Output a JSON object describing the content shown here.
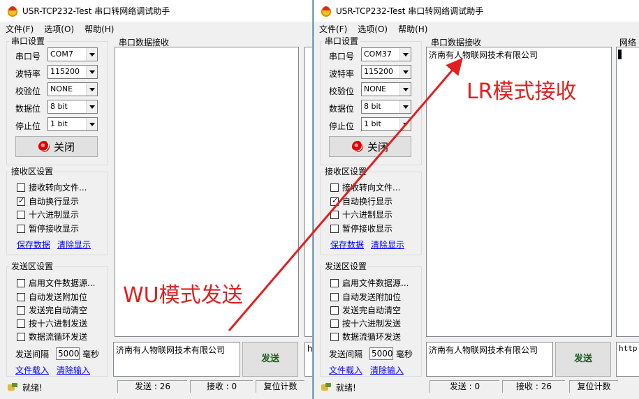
{
  "colors": {
    "accent": "#1979ca",
    "annotation": "#e02020",
    "link": "#0000ff"
  },
  "left": {
    "title": "USR-TCP232-Test 串口转网络调试助手",
    "menu": [
      "文件(F)",
      "选项(O)",
      "帮助(H)"
    ],
    "serial_group": "串口设置",
    "serial_rows": [
      {
        "label": "串口号",
        "value": "COM7"
      },
      {
        "label": "波特率",
        "value": "115200"
      },
      {
        "label": "校验位",
        "value": "NONE"
      },
      {
        "label": "数据位",
        "value": "8 bit"
      },
      {
        "label": "停止位",
        "value": "1 bit"
      }
    ],
    "close_label": "关闭",
    "recv_group": "接收区设置",
    "recv_checks": [
      {
        "label": "接收转向文件...",
        "checked": false
      },
      {
        "label": "自动换行显示",
        "checked": true
      },
      {
        "label": "十六进制显示",
        "checked": false
      },
      {
        "label": "暂停接收显示",
        "checked": false
      }
    ],
    "save_data": "保存数据",
    "clear_display": "清除显示",
    "send_group": "发送区设置",
    "send_checks": [
      {
        "label": "启用文件数据源...",
        "checked": false
      },
      {
        "label": "自动发送附加位",
        "checked": false
      },
      {
        "label": "发送完自动清空",
        "checked": false
      },
      {
        "label": "按十六进制发送",
        "checked": false
      },
      {
        "label": "数据流循环发送",
        "checked": false
      }
    ],
    "interval_label": "发送间隔",
    "interval_value": "5000",
    "interval_unit": "毫秒",
    "load_file": "文件载入",
    "clear_input": "清除输入",
    "recv_panel_label": "串口数据接收",
    "recv_content": "",
    "send_content": "济南有人物联网技术有限公司",
    "send_button": "发送",
    "right_partial_send": "ht",
    "status_ready": "就绪!",
    "status_sent": "发送 : 26",
    "status_recv": "接收 : 0",
    "status_reset": "复位计数"
  },
  "right": {
    "title": "USR-TCP232-Test 串口转网络调试助手",
    "menu": [
      "文件(F)",
      "选项(O)",
      "帮助(H)"
    ],
    "serial_group": "串口设置",
    "serial_rows": [
      {
        "label": "串口号",
        "value": "COM37"
      },
      {
        "label": "波特率",
        "value": "115200"
      },
      {
        "label": "校验位",
        "value": "NONE"
      },
      {
        "label": "数据位",
        "value": "8 bit"
      },
      {
        "label": "停止位",
        "value": "1 bit"
      }
    ],
    "close_label": "关闭",
    "recv_group": "接收区设置",
    "recv_checks": [
      {
        "label": "接收转向文件...",
        "checked": false
      },
      {
        "label": "自动换行显示",
        "checked": true
      },
      {
        "label": "十六进制显示",
        "checked": false
      },
      {
        "label": "暂停接收显示",
        "checked": false
      }
    ],
    "save_data": "保存数据",
    "clear_display": "清除显示",
    "send_group": "发送区设置",
    "send_checks": [
      {
        "label": "启用文件数据源...",
        "checked": false
      },
      {
        "label": "自动发送附加位",
        "checked": false
      },
      {
        "label": "发送完自动清空",
        "checked": false
      },
      {
        "label": "按十六进制发送",
        "checked": false
      },
      {
        "label": "数据流循环发送",
        "checked": false
      }
    ],
    "interval_label": "发送间隔",
    "interval_value": "5000",
    "interval_unit": "毫秒",
    "load_file": "文件载入",
    "clear_input": "清除输入",
    "recv_panel_label": "串口数据接收",
    "recv_content": "济南有人物联网技术有限公司",
    "send_content": "济南有人物联网技术有限公司",
    "send_button": "发送",
    "net_panel_label": "网络数",
    "net_send_partial": "http:",
    "status_ready": "就绪!",
    "status_sent": "发送 : 0",
    "status_recv": "接收 : 26",
    "status_reset": "复位计数"
  },
  "annotations": {
    "send_mode": "WU模式发送",
    "recv_mode": "LR模式接收"
  }
}
